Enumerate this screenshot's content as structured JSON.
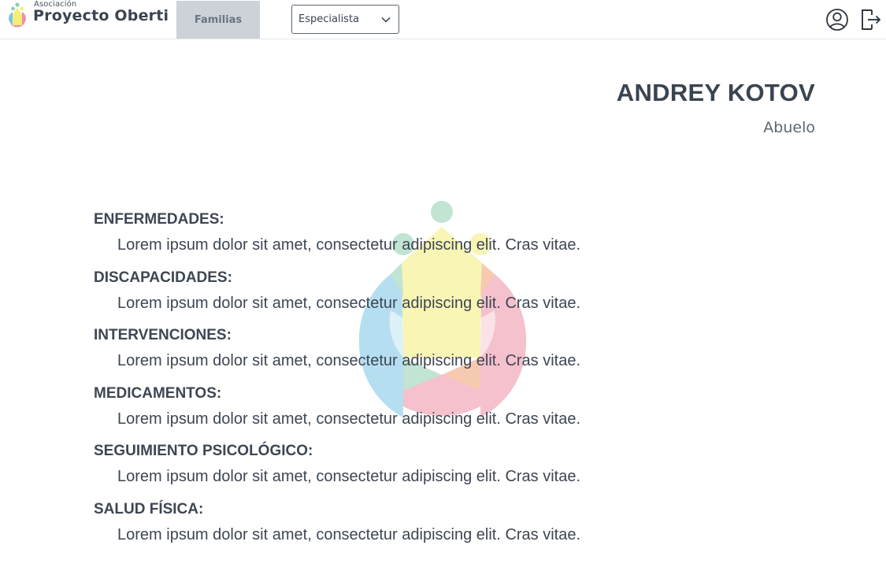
{
  "header": {
    "brand_small": "Asociación",
    "brand_name": "Proyecto Oberti",
    "nav_tab": "Familias",
    "role_select": {
      "value": "Especialista"
    },
    "icons": [
      "user-circle-icon",
      "logout-icon",
      "chevron-down-icon",
      "brand-logo-icon"
    ]
  },
  "person": {
    "name": "ANDREY KOTOV",
    "relation": "Abuelo"
  },
  "sections": [
    {
      "label": "ENFERMEDADES:",
      "text": "Lorem ipsum dolor sit amet, consectetur adipiscing elit. Cras vitae."
    },
    {
      "label": "DISCAPACIDADES:",
      "text": "Lorem ipsum dolor sit amet, consectetur adipiscing elit. Cras vitae."
    },
    {
      "label": "INTERVENCIONES:",
      "text": "Lorem ipsum dolor sit amet, consectetur adipiscing elit. Cras vitae."
    },
    {
      "label": "MEDICAMENTOS:",
      "text": "Lorem ipsum dolor sit amet, consectetur adipiscing elit. Cras vitae."
    },
    {
      "label": "SEGUIMIENTO PSICOLÓGICO:",
      "text": "Lorem ipsum dolor sit amet, consectetur adipiscing elit. Cras vitae."
    },
    {
      "label": "SALUD FÍSICA:",
      "text": "Lorem ipsum dolor sit amet, consectetur adipiscing elit. Cras vitae."
    }
  ],
  "colors": {
    "text": "#3a4451",
    "nav_active_bg": "#cdd2d8",
    "logo_green": "#8fcfb0",
    "logo_yellow": "#f3ee7a",
    "logo_blue": "#7cc4e6",
    "logo_pink": "#ee8fa6",
    "logo_orange": "#f0a070"
  }
}
